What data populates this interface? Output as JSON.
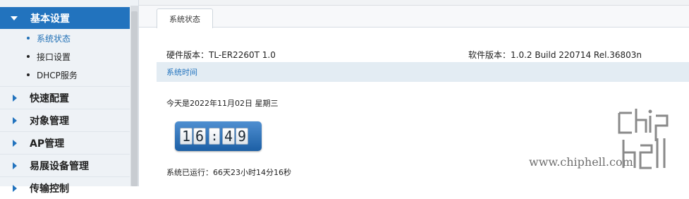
{
  "sidebar": {
    "active_menu": {
      "label": "基本设置",
      "icon": "chevron-down-icon"
    },
    "sub_items": [
      {
        "label": "系统状态",
        "selected": true
      },
      {
        "label": "接口设置",
        "selected": false
      },
      {
        "label": "DHCP服务",
        "selected": false
      }
    ],
    "menus": [
      {
        "label": "快速配置",
        "icon": "chevron-right-icon"
      },
      {
        "label": "对象管理",
        "icon": "chevron-right-icon"
      },
      {
        "label": "AP管理",
        "icon": "chevron-right-icon"
      },
      {
        "label": "易展设备管理",
        "icon": "chevron-right-icon"
      },
      {
        "label": "传输控制",
        "icon": "chevron-right-icon"
      }
    ]
  },
  "tabs": [
    {
      "label": "系统状态"
    }
  ],
  "status": {
    "hardware": "硬件版本：TL-ER2260T 1.0",
    "software": "软件版本：1.0.2 Build 220714 Rel.36803n",
    "section_title": "系统时间",
    "date_text": "今天是2022年11月02日 星期三",
    "clock_digits": [
      "1",
      "6",
      ":",
      "4",
      "9"
    ],
    "uptime_text": "系统已运行：66天23小时14分16秒"
  },
  "watermark": {
    "url": "www.chiphell.com"
  },
  "colors": {
    "accent": "#2273be",
    "section_bg": "#e3ecf3",
    "sidebar_bg": "#eef2f6"
  }
}
